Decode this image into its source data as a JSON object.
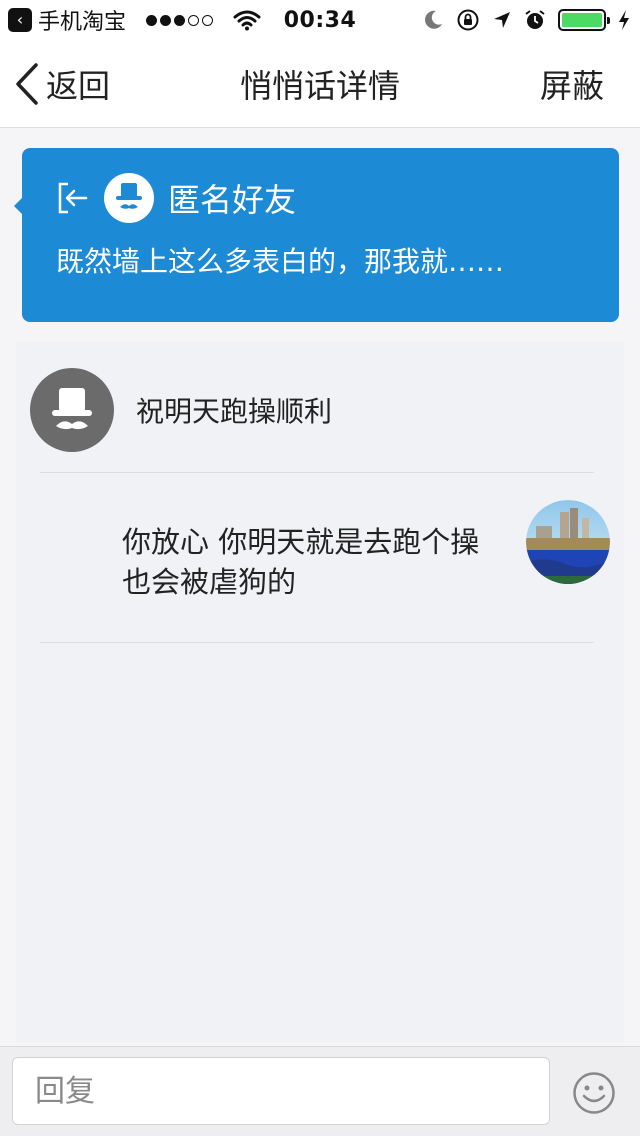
{
  "status_bar": {
    "back_app_label": "手机淘宝",
    "time": "00:34",
    "battery_level": 1.0,
    "signal_filled": 3,
    "signal_total": 5
  },
  "nav": {
    "back_label": "返回",
    "title": "悄悄话详情",
    "right_label": "屏蔽"
  },
  "card": {
    "name": "匿名好友",
    "message": "既然墙上这么多表白的，那我就……"
  },
  "conversation": {
    "anon_message": "祝明天跑操顺利",
    "reply_message": "你放心 你明天就是去跑个操 也会被虐狗的"
  },
  "input_bar": {
    "placeholder": "回复"
  },
  "colors": {
    "accent": "#1d8ad6",
    "battery": "#4cd964"
  },
  "icons": {
    "back": "chevron-left-icon",
    "exit": "exit-icon",
    "anonymous": "hat-mustache-icon",
    "emoji": "smiley-icon"
  }
}
